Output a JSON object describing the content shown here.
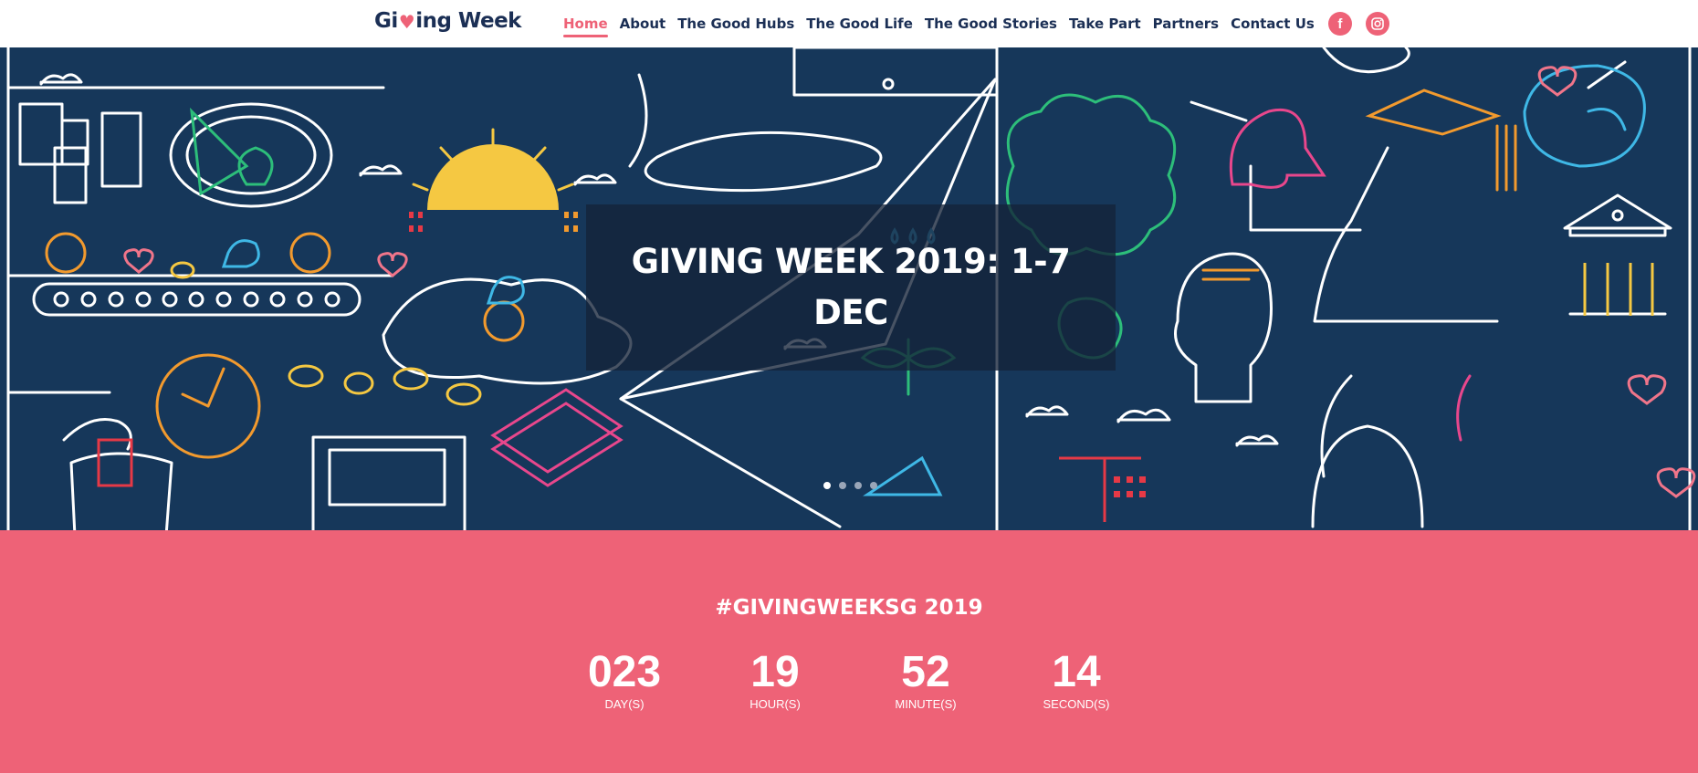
{
  "header": {
    "logo": {
      "part1": "Gi",
      "part2": "ing Week"
    },
    "nav": [
      {
        "label": "Home",
        "active": true
      },
      {
        "label": "About",
        "active": false
      },
      {
        "label": "The Good Hubs",
        "active": false
      },
      {
        "label": "The Good Life",
        "active": false
      },
      {
        "label": "The Good Stories",
        "active": false
      },
      {
        "label": "Take Part",
        "active": false
      },
      {
        "label": "Partners",
        "active": false
      },
      {
        "label": "Contact Us",
        "active": false
      }
    ],
    "social": [
      {
        "icon": "facebook-icon",
        "glyph": "f"
      },
      {
        "icon": "instagram-icon"
      }
    ]
  },
  "hero": {
    "title": "GIVING WEEK 2019: 1-7 DEC",
    "slides": 4,
    "active_slide": 1
  },
  "countdown": {
    "title": "#GIVINGWEEKSG 2019",
    "units": [
      {
        "value": "023",
        "label": "DAY(S)"
      },
      {
        "value": "19",
        "label": "HOUR(S)"
      },
      {
        "value": "52",
        "label": "MINUTE(S)"
      },
      {
        "value": "14",
        "label": "SECOND(S)"
      }
    ]
  },
  "colors": {
    "brand_pink": "#ee6277",
    "navy": "#1b2f55",
    "hero_bg": "#16375a"
  }
}
